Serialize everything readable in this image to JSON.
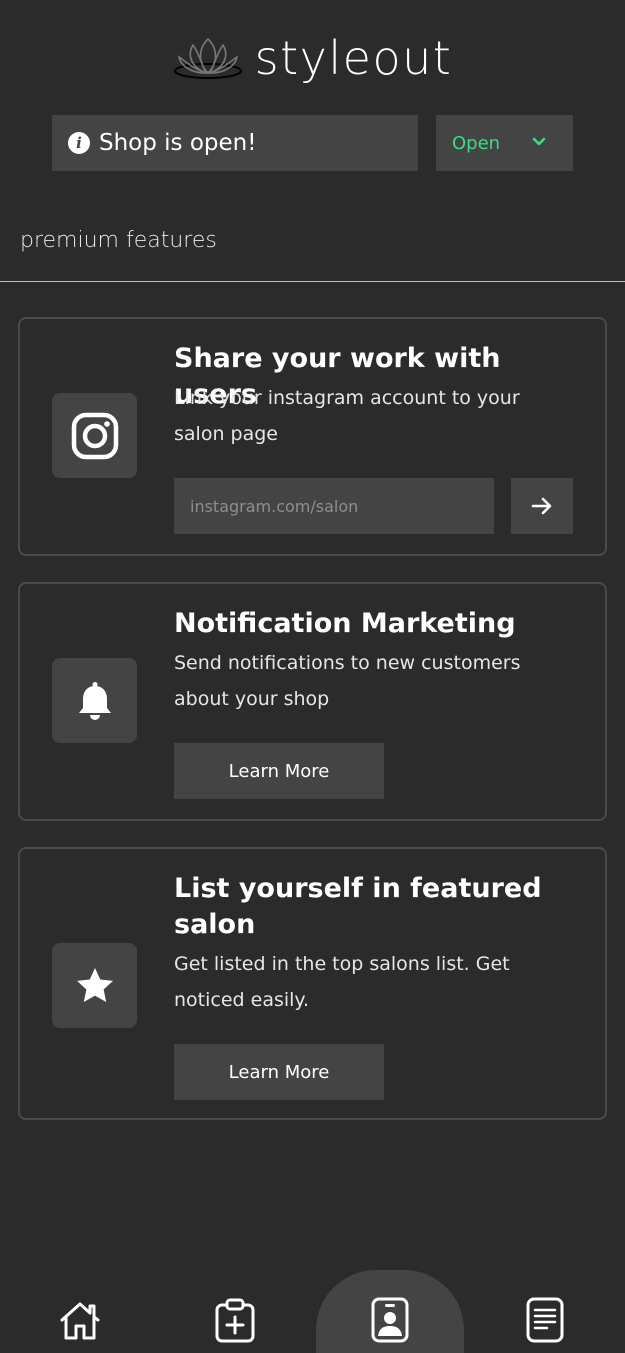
{
  "app": {
    "brand_name": "styleout",
    "logo_icon": "lotus-icon"
  },
  "status": {
    "message": "Shop is open!",
    "info_icon": "info-icon",
    "select_value": "Open",
    "select_icon": "chevron-down-icon",
    "accent_color": "#3ddc84"
  },
  "section": {
    "title": "premium features"
  },
  "cards": [
    {
      "icon": "instagram-icon",
      "title": "Share your work with users",
      "description": "Link your instagram account to your salon page",
      "input_placeholder": "instagram.com/salon",
      "input_value": "",
      "submit_icon": "arrow-right-icon"
    },
    {
      "icon": "bell-icon",
      "title": "Notification Marketing",
      "description": "Send notifications to new customers about your shop",
      "button_label": "Learn More"
    },
    {
      "icon": "star-icon",
      "title": "List yourself in featured salon",
      "description": "Get listed in the top salons list. Get noticed easily.",
      "button_label": "Learn More"
    }
  ],
  "bottom_nav": {
    "items": [
      {
        "icon": "home-icon",
        "active": false
      },
      {
        "icon": "clipboard-add-icon",
        "active": false
      },
      {
        "icon": "profile-badge-icon",
        "active": true
      },
      {
        "icon": "document-icon",
        "active": false
      }
    ]
  },
  "colors": {
    "background": "#2b2b2c",
    "surface": "#444445",
    "accent": "#3ddc84"
  }
}
